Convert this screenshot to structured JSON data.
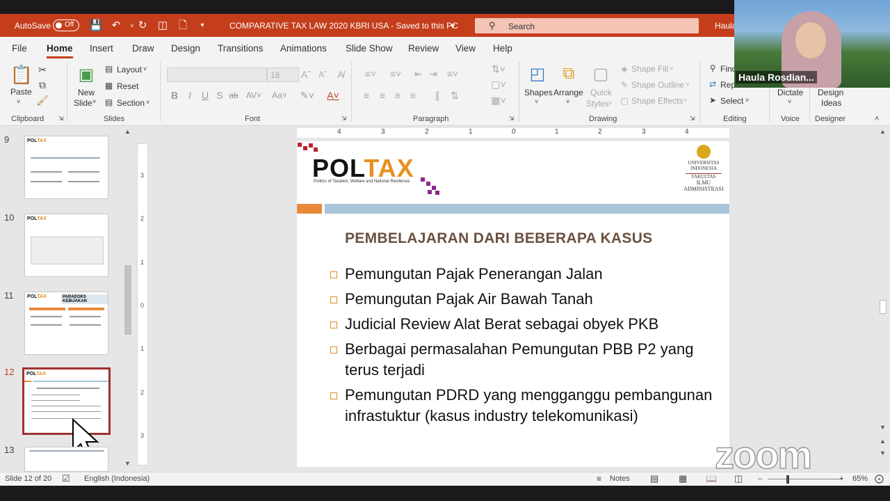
{
  "titlebar": {
    "autosave": "AutoSave",
    "toggle": "Off",
    "document_title": "COMPARATIVE TAX LAW 2020 KBRI USA  -  Saved to this PC",
    "search_placeholder": "Search",
    "user": "Haula"
  },
  "tabs": [
    "File",
    "Home",
    "Insert",
    "Draw",
    "Design",
    "Transitions",
    "Animations",
    "Slide Show",
    "Review",
    "View",
    "Help"
  ],
  "ribbon": {
    "clipboard": {
      "paste": "Paste",
      "label": "Clipboard"
    },
    "slides": {
      "new_slide_1": "New",
      "new_slide_2": "Slide",
      "layout": "Layout",
      "reset": "Reset",
      "section": "Section",
      "label": "Slides"
    },
    "font": {
      "size": "18",
      "label": "Font"
    },
    "paragraph": {
      "label": "Paragraph"
    },
    "drawing": {
      "shapes": "Shapes",
      "arrange": "Arrange",
      "quick_1": "Quick",
      "quick_2": "Styles",
      "shape_fill": "Shape Fill",
      "shape_outline": "Shape Outline",
      "shape_effects": "Shape Effects",
      "label": "Drawing"
    },
    "editing": {
      "find": "Find",
      "replace": "Rep",
      "select": "Select",
      "label": "Editing"
    },
    "voice": {
      "dictate": "Dictate",
      "label": "Voice"
    },
    "designer": {
      "ideas_1": "Design",
      "ideas_2": "Ideas",
      "label": "Designer"
    }
  },
  "thumbnails": [
    {
      "number": "9",
      "selected": false
    },
    {
      "number": "10",
      "selected": false
    },
    {
      "number": "11",
      "selected": false,
      "banner": "PARADOKS KEBIJAKAN"
    },
    {
      "number": "12",
      "selected": true
    },
    {
      "number": "13",
      "selected": false
    }
  ],
  "slide": {
    "logo_left": "POL",
    "logo_right": "TAX",
    "logo_sub": "Politics of Taxation, Welfare and National Resilience",
    "univ_1": "UNIVERSITAS",
    "univ_2": "INDONESIA",
    "fakultas": "FAKULTAS",
    "dept_1": "ILMU",
    "dept_2": "ADMINISTRASI",
    "title": "PEMBELAJARAN DARI BEBERAPA KASUS",
    "bullets": [
      "Pemungutan Pajak Penerangan Jalan",
      "Pemungutan Pajak Air Bawah Tanah",
      "Judicial Review Alat Berat sebagai obyek PKB",
      "Berbagai permasalahan Pemungutan PBB P2 yang terus terjadi",
      "Pemungutan PDRD yang mengganggu pembangunan infrastuktur (kasus industry telekomunikasi)"
    ]
  },
  "ruler_h": [
    "4",
    "3",
    "2",
    "1",
    "0",
    "1",
    "2",
    "3",
    "4"
  ],
  "ruler_v": [
    "3",
    "2",
    "1",
    "0",
    "1",
    "2",
    "3"
  ],
  "status": {
    "slide_info": "Slide 12 of 20",
    "language": "English (Indonesia)",
    "notes": "Notes",
    "zoom": "65%",
    "zoom_level": 0.65
  },
  "video": {
    "name": "Haula Rosdian..."
  },
  "watermark": "zoom",
  "colors": {
    "accent": "#c43e1c",
    "orange": "#e8893a",
    "band_blue": "#a8c4d9",
    "title_brown": "#6b5040"
  }
}
